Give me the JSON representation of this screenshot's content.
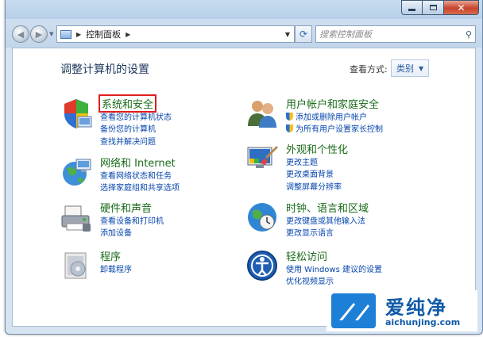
{
  "window": {
    "caption": {
      "min_icon": "minimize-icon",
      "max_icon": "maximize-icon",
      "close_label": "✕"
    }
  },
  "navbar": {
    "breadcrumb": "控制面板",
    "search_placeholder": "搜索控制面板"
  },
  "content": {
    "heading": "调整计算机的设置",
    "view_by_label": "查看方式:",
    "view_by_value": "类别"
  },
  "categories": {
    "left": [
      {
        "title": "系统和安全",
        "highlighted": true,
        "icon": "shield-security-icon",
        "links": [
          "查看您的计算机状态",
          "备份您的计算机",
          "查找并解决问题"
        ]
      },
      {
        "title": "网络和 Internet",
        "icon": "globe-network-icon",
        "links": [
          "查看网络状态和任务",
          "选择家庭组和共享选项"
        ]
      },
      {
        "title": "硬件和声音",
        "icon": "printer-hardware-icon",
        "links": [
          "查看设备和打印机",
          "添加设备"
        ]
      },
      {
        "title": "程序",
        "icon": "programs-box-icon",
        "links": [
          "卸载程序"
        ]
      }
    ],
    "right": [
      {
        "title": "用户帐户和家庭安全",
        "icon": "users-icon",
        "links": [
          "添加或删除用户帐户",
          "为所有用户设置家长控制"
        ],
        "link_shields": [
          true,
          true
        ]
      },
      {
        "title": "外观和个性化",
        "icon": "appearance-icon",
        "links": [
          "更改主题",
          "更改桌面背景",
          "调整屏幕分辨率"
        ]
      },
      {
        "title": "时钟、语言和区域",
        "icon": "clock-globe-icon",
        "links": [
          "更改键盘或其他输入法",
          "更改显示语言"
        ]
      },
      {
        "title": "轻松访问",
        "icon": "ease-of-access-icon",
        "links": [
          "使用 Windows 建议的设置",
          "优化视频显示"
        ]
      }
    ]
  },
  "watermark": {
    "text": "爱纯净",
    "url": "aichunjing.com"
  },
  "colors": {
    "category_title": "#1a6b1a",
    "link": "#0645ad",
    "highlight_box": "#e11e1e",
    "watermark": "#0f5aa8"
  }
}
